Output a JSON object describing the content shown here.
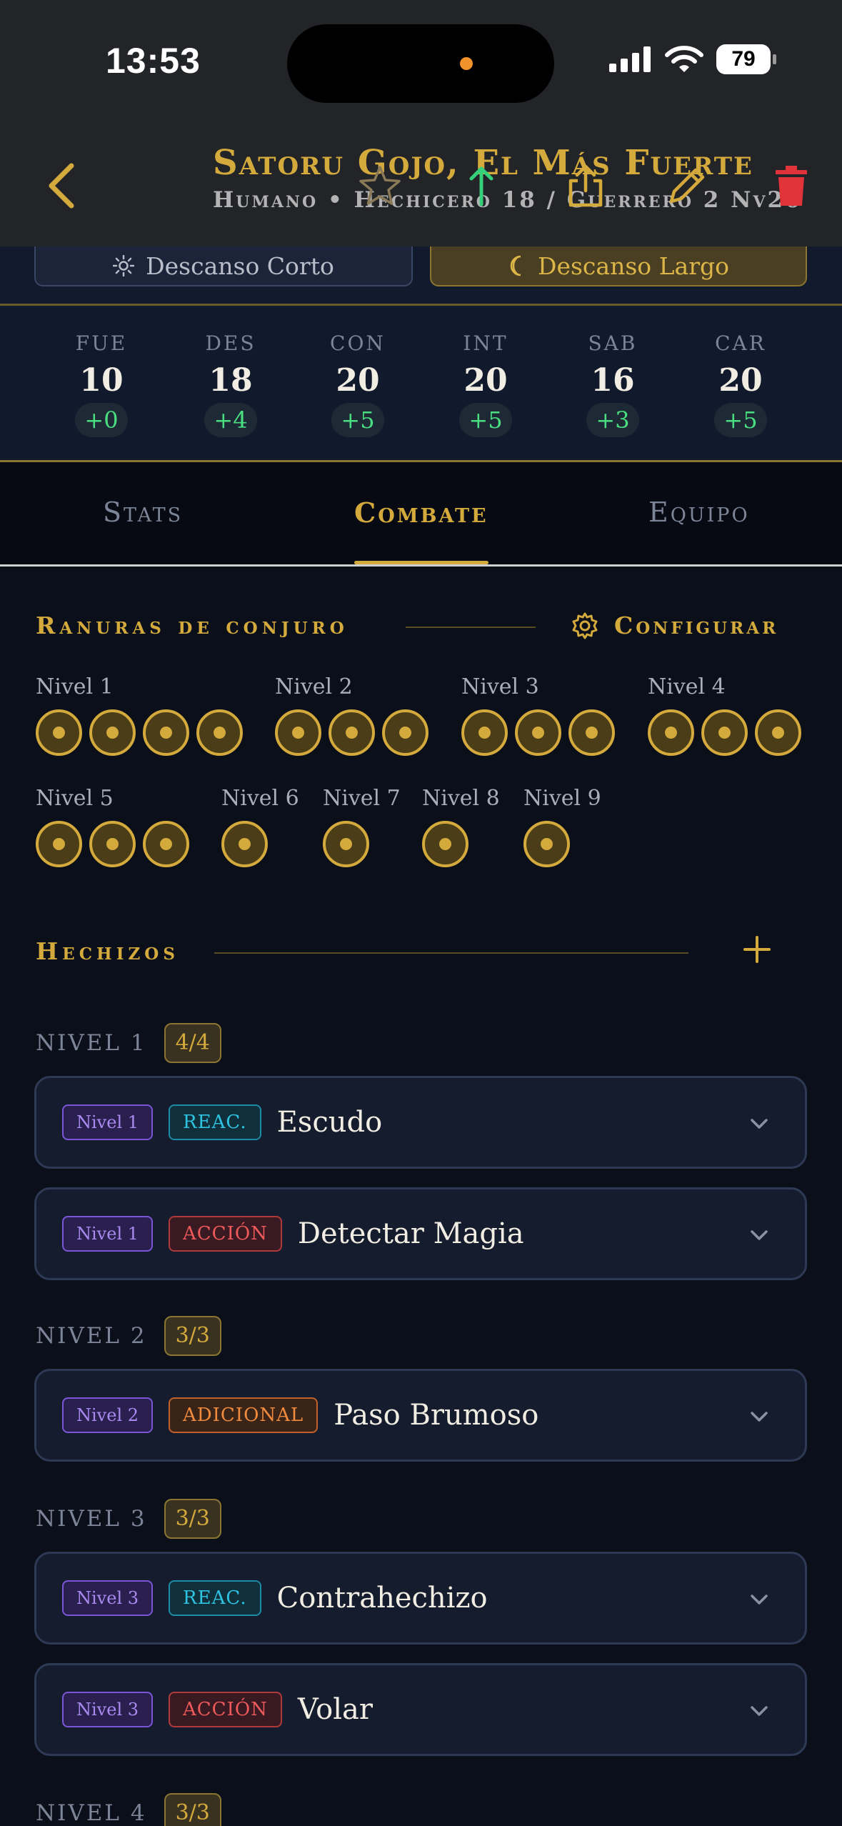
{
  "status": {
    "time": "13:53",
    "battery": "79"
  },
  "header": {
    "title": "Satoru Gojo, El Más Fuerte",
    "subtitle": "Humano • Hechicero 18 / Guerrero 2 Nv20"
  },
  "rest": {
    "short": "Descanso Corto",
    "long": "Descanso Largo"
  },
  "abilities": [
    {
      "name": "FUE",
      "score": "10",
      "mod": "+0"
    },
    {
      "name": "DES",
      "score": "18",
      "mod": "+4"
    },
    {
      "name": "CON",
      "score": "20",
      "mod": "+5"
    },
    {
      "name": "INT",
      "score": "20",
      "mod": "+5"
    },
    {
      "name": "SAB",
      "score": "16",
      "mod": "+3"
    },
    {
      "name": "CAR",
      "score": "20",
      "mod": "+5"
    }
  ],
  "tabs": [
    {
      "label": "Stats"
    },
    {
      "label": "Combate",
      "active": true
    },
    {
      "label": "Equipo"
    }
  ],
  "slots_section": {
    "title": "Ranuras de conjuro",
    "configure": "Configurar",
    "levels": [
      {
        "label": "Nivel 1",
        "slots": 4
      },
      {
        "label": "Nivel 2",
        "slots": 3
      },
      {
        "label": "Nivel 3",
        "slots": 3
      },
      {
        "label": "Nivel 4",
        "slots": 3
      },
      {
        "label": "Nivel 5",
        "slots": 3
      },
      {
        "label": "Nivel 6",
        "slots": 1
      },
      {
        "label": "Nivel 7",
        "slots": 1
      },
      {
        "label": "Nivel 8",
        "slots": 1
      },
      {
        "label": "Nivel 9",
        "slots": 1
      }
    ]
  },
  "spells_section": {
    "title": "Hechizos",
    "groups": [
      {
        "name": "NIVEL 1",
        "count": "4/4"
      },
      {
        "name": "NIVEL 2",
        "count": "3/3"
      },
      {
        "name": "NIVEL 3",
        "count": "3/3"
      },
      {
        "name": "NIVEL 4",
        "count": "3/3"
      }
    ],
    "spells": [
      {
        "level_tag": "Nivel 1",
        "type_tag": "REAC.",
        "name": "Escudo"
      },
      {
        "level_tag": "Nivel 1",
        "type_tag": "ACCIÓN",
        "name": "Detectar Magia"
      },
      {
        "level_tag": "Nivel 2",
        "type_tag": "ADICIONAL",
        "name": "Paso Brumoso"
      },
      {
        "level_tag": "Nivel 3",
        "type_tag": "REAC.",
        "name": "Contrahechizo"
      },
      {
        "level_tag": "Nivel 3",
        "type_tag": "ACCIÓN",
        "name": "Volar"
      }
    ]
  },
  "colors": {
    "gold": "#d4aa3c",
    "background": "#0b0f1a",
    "modifier_green": "#4ade80",
    "delete_red": "#e0333a",
    "upgrade_green": "#34d07a"
  }
}
